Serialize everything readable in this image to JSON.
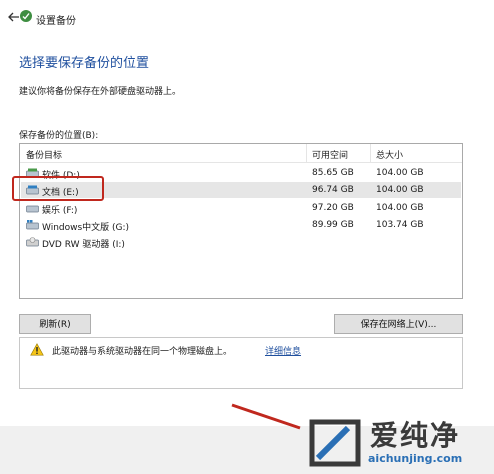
{
  "window": {
    "title": "设置备份"
  },
  "page": {
    "heading": "选择要保存备份的位置",
    "description": "建议你将备份保存在外部硬盘驱动器上。",
    "list_label": "保存备份的位置(B):"
  },
  "table": {
    "columns": [
      "备份目标",
      "可用空间",
      "总大小"
    ],
    "rows": [
      {
        "name": "软件 (D:)",
        "free": "85.65 GB",
        "total": "104.00 GB",
        "icon": "hard-drive-icon"
      },
      {
        "name": "文档 (E:)",
        "free": "96.74 GB",
        "total": "104.00 GB",
        "icon": "hard-drive-icon",
        "selected": true
      },
      {
        "name": "娱乐 (F:)",
        "free": "97.20 GB",
        "total": "104.00 GB",
        "icon": "hard-drive-icon"
      },
      {
        "name": "Windows中文版 (G:)",
        "free": "89.99 GB",
        "total": "103.74 GB",
        "icon": "windows-drive-icon"
      },
      {
        "name": "DVD RW 驱动器 (I:)",
        "free": "",
        "total": "",
        "icon": "dvd-drive-icon"
      }
    ]
  },
  "buttons": {
    "refresh": "刷新(R)",
    "save_network": "保存在网络上(V)..."
  },
  "info": {
    "message": "此驱动器与系统驱动器在同一个物理磁盘上。",
    "link": "详细信息"
  },
  "watermark": {
    "name": "爱纯净",
    "url": "aichunjing.com"
  },
  "colors": {
    "heading": "#1f4f9e",
    "highlight": "#c0281e",
    "url": "#2a6fb5"
  }
}
